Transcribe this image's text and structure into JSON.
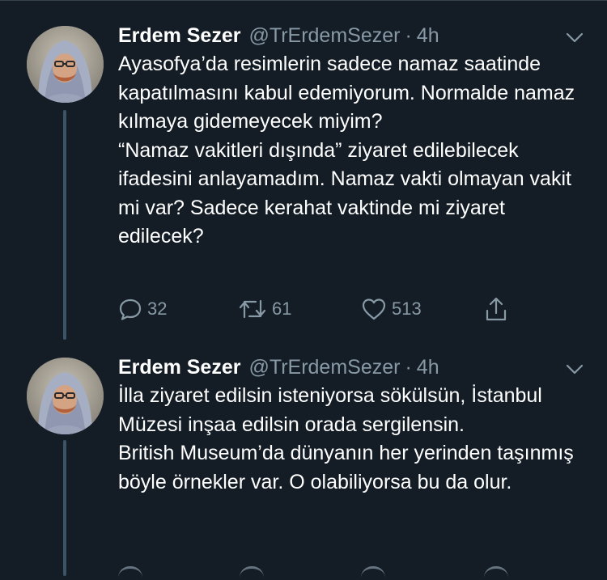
{
  "tweets": [
    {
      "author_name": "Erdem Sezer",
      "handle": "@TrErdemSezer",
      "separator": "·",
      "time": "4h",
      "text": "Ayasofya’da resimlerin sadece namaz saatinde kapatılmasını kabul edemiyorum. Normalde namaz kılmaya gidemeyecek miyim?\n“Namaz vakitleri dışında” ziyaret edilebilecek ifadesini anlayamadım. Namaz vakti olmayan vakit mi var? Sadece kerahat vaktinde mi ziyaret edilecek?",
      "replies": "32",
      "retweets": "61",
      "likes": "513"
    },
    {
      "author_name": "Erdem Sezer",
      "handle": "@TrErdemSezer",
      "separator": "·",
      "time": "4h",
      "text": "İlla ziyaret edilsin isteniyorsa sökülsün, İstanbul Müzesi inşaa edilsin orada sergilensin.\nBritish Museum’da dünyanın her yerinden taşınmış böyle örnekler var. O olabiliyorsa bu da olur."
    }
  ],
  "icons": {
    "reply": "reply-icon",
    "retweet": "retweet-icon",
    "like": "heart-icon",
    "share": "share-icon",
    "menu": "chevron-down-icon"
  },
  "colors": {
    "background": "#141d26",
    "secondary_text": "#8899a6",
    "thread_line": "#3d5466"
  }
}
